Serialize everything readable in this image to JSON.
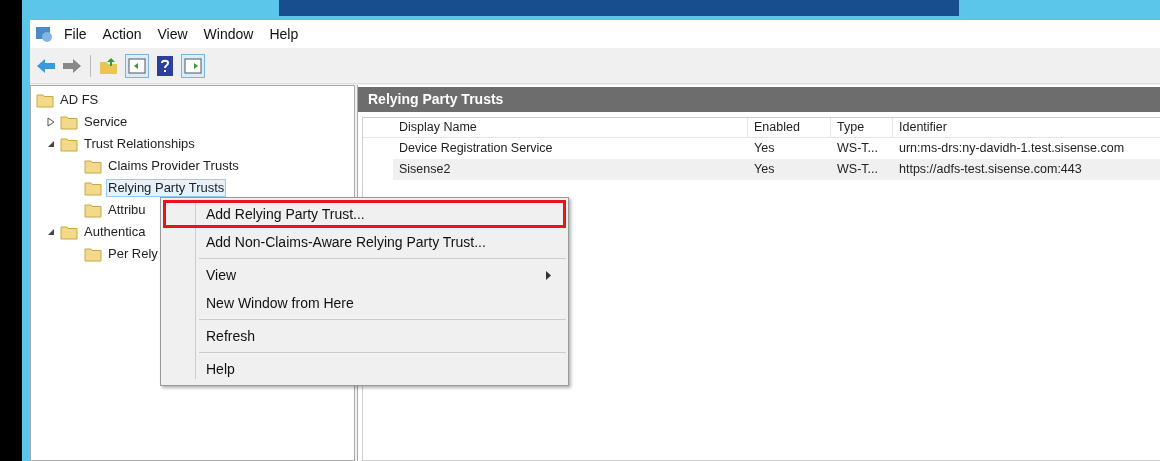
{
  "menu_bar": [
    "File",
    "Action",
    "View",
    "Window",
    "Help"
  ],
  "tree": [
    {
      "label": "AD FS",
      "selected": false,
      "children": [
        {
          "label": "Service",
          "expanded": false,
          "selected": false
        },
        {
          "label": "Trust Relationships",
          "expanded": true,
          "selected": false,
          "children": [
            {
              "label": "Claims Provider Trusts",
              "selected": false
            },
            {
              "label": "Relying Party Trusts",
              "selected": true
            },
            {
              "label": "Attribu",
              "selected": false
            }
          ]
        },
        {
          "label": "Authentica",
          "expanded": true,
          "selected": false,
          "children": [
            {
              "label": "Per Rely",
              "selected": false
            }
          ]
        }
      ]
    }
  ],
  "panel": {
    "title": "Relying Party Trusts",
    "columns": [
      "Display Name",
      "Enabled",
      "Type",
      "Identifier"
    ],
    "rows": [
      {
        "cells": [
          "Device Registration Service",
          "Yes",
          "WS-T...",
          "urn:ms-drs:ny-davidh-1.test.sisense.com"
        ],
        "selected": false
      },
      {
        "cells": [
          "Sisense2",
          "Yes",
          "WS-T...",
          "https://adfs-test.sisense.com:443"
        ],
        "selected": true
      }
    ]
  },
  "context_menu": [
    {
      "kind": "item",
      "label": "Add Relying Party Trust...",
      "highlighted": true
    },
    {
      "kind": "item",
      "label": "Add Non-Claims-Aware Relying Party Trust...",
      "highlighted": false
    },
    {
      "kind": "separator"
    },
    {
      "kind": "submenu",
      "label": "View",
      "highlighted": false
    },
    {
      "kind": "item",
      "label": "New Window from Here",
      "highlighted": false
    },
    {
      "kind": "separator"
    },
    {
      "kind": "item",
      "label": "Refresh",
      "highlighted": false
    },
    {
      "kind": "separator"
    },
    {
      "kind": "item",
      "label": "Help",
      "highlighted": false
    }
  ]
}
